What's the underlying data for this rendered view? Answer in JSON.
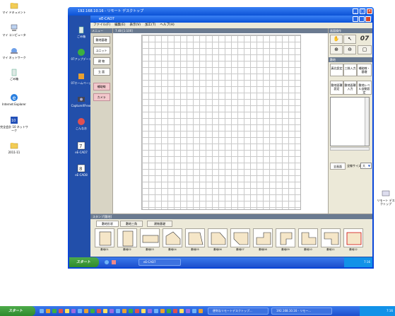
{
  "outer_desktop": {
    "icons": [
      {
        "label": "マイ ドキュメント",
        "icon": "folder-icon"
      },
      {
        "label": "マイ コンピュータ",
        "icon": "computer-icon"
      },
      {
        "label": "マイ ネットワーク",
        "icon": "network-icon"
      },
      {
        "label": "ごみ箱",
        "icon": "recycle-bin-icon"
      },
      {
        "label": "Internet Explorer",
        "icon": "ie-icon"
      },
      {
        "label": "完全会計 10 ネットワーク",
        "icon": "app-icon"
      },
      {
        "label": "2011-11",
        "icon": "folder-icon"
      }
    ],
    "side_label": "リモート デスクトップ"
  },
  "remote_window": {
    "title": "192.168.10.16 - リモート デスクトップ"
  },
  "inner_desktop": {
    "icons": [
      {
        "label": "ごみ箱",
        "icon": "recycle-bin-icon"
      },
      {
        "label": "07アップデート",
        "icon": "update-icon"
      },
      {
        "label": "07ホームページ",
        "icon": "homepage-icon"
      },
      {
        "label": "CaptureXP.exe",
        "icon": "capture-icon"
      },
      {
        "label": "こんなお",
        "icon": "app-icon"
      },
      {
        "label": "eE-CAD7",
        "icon": "cad-icon"
      },
      {
        "label": "eE-CAD8",
        "icon": "cad-icon"
      }
    ]
  },
  "app": {
    "title": "eE-CAD7",
    "menu": [
      "ファイル(F)",
      "編集(E)",
      "表示(V)",
      "加工(T)",
      "ヘルプ(H)"
    ],
    "left_panel": {
      "header": "メニュー",
      "buttons": [
        "敷地基礎",
        "ユニット",
        "建 物",
        "立 面"
      ],
      "pink_buttons": [
        "補助線",
        "カメラ"
      ]
    },
    "canvas_header": "7.48 [1:100]",
    "right_panel": {
      "view_header": "画面操作",
      "view_tools": [
        "hand-icon",
        "pointer-icon",
        "zoom-in-icon",
        "zoom-out-icon"
      ],
      "logo": "07",
      "layout_header": "敷地",
      "tabs": [
        "真北設定",
        "三斜入力",
        "補助線・基礎"
      ],
      "op_buttons": [
        "敷地面積設定",
        "敷地面積入力",
        "敷地レベル自動設定"
      ],
      "bottom_button": "全画面",
      "size_label": "全線サイズ",
      "size_value": "大"
    },
    "stamp_panel": {
      "header": "スタンプ[敷地]",
      "tabs": [
        "敷地形状",
        "敷地三角",
        "建物基礎"
      ],
      "stamps": [
        "敷地01",
        "敷地02",
        "敷地03",
        "敷地04",
        "敷地05",
        "敷地06",
        "敷地07",
        "敷地08",
        "敷地09",
        "敷地10",
        "敷地11",
        "敷地12"
      ]
    }
  },
  "inner_taskbar": {
    "start": "スタート",
    "task": "eE-CAD7",
    "clock": "7:16"
  },
  "outer_taskbar": {
    "start": "スタート",
    "tasks": [
      "便利なリモートデスクトップ...",
      "192.168.10.16 - リモー..."
    ],
    "clock": "7:16"
  },
  "colors": {
    "xp_blue": "#0a46d8",
    "desktop_blue": "#224faa",
    "start_green": "#3a9a37",
    "panel_header": "#6a7a90",
    "stamp_fill": "#f5e6c8"
  }
}
